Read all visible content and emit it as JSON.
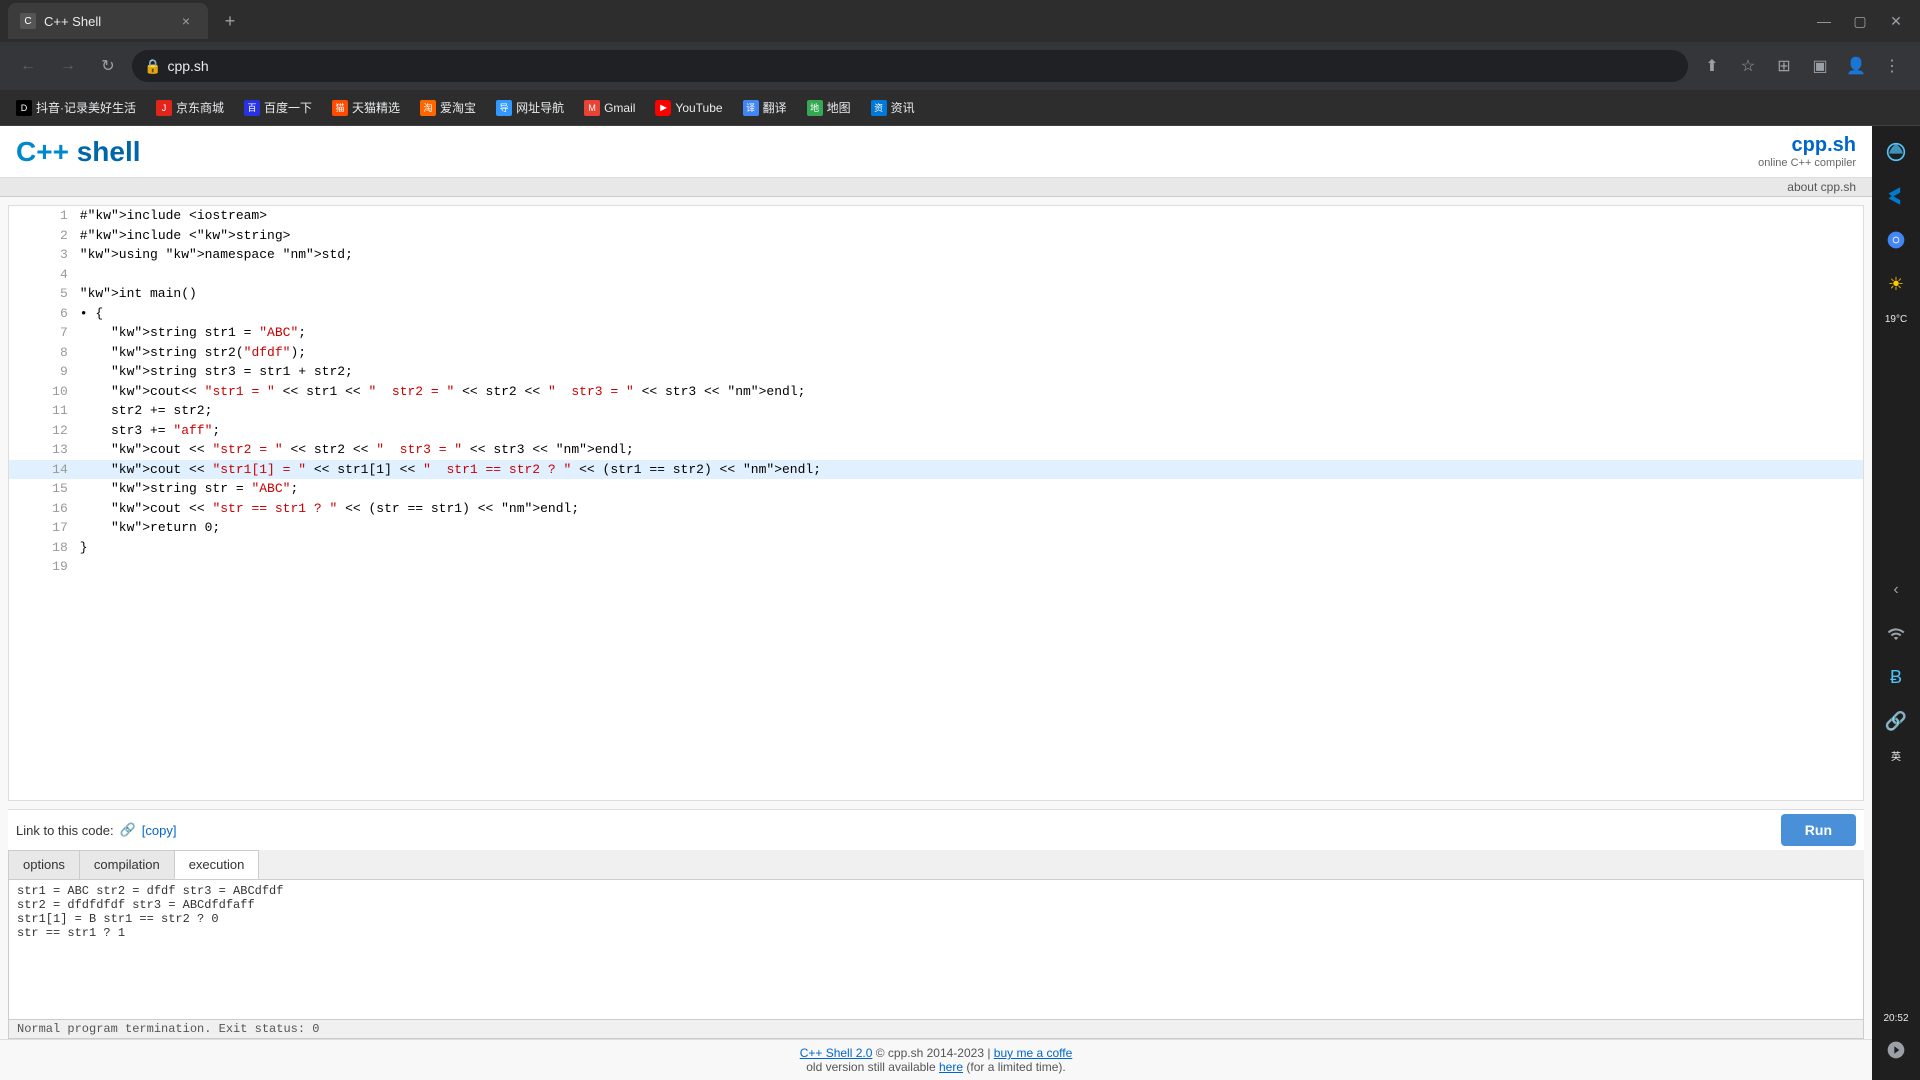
{
  "browser": {
    "tab": {
      "favicon": "C",
      "title": "C++ Shell",
      "close_label": "×"
    },
    "new_tab_label": "+",
    "window_controls": {
      "minimize": "—",
      "maximize": "▢",
      "close": "✕"
    },
    "nav": {
      "back_label": "←",
      "forward_label": "→",
      "refresh_label": "↻"
    },
    "address": "cpp.sh",
    "toolbar_icons": [
      "⬆",
      "☆",
      "⊞",
      "▣",
      "👤",
      "⋮"
    ]
  },
  "bookmarks": [
    {
      "id": "douyin",
      "icon": "D",
      "label": "抖音·记录美好生活"
    },
    {
      "id": "jingdong",
      "icon": "J",
      "label": "京东商城"
    },
    {
      "id": "baidu",
      "icon": "百",
      "label": "百度一下"
    },
    {
      "id": "tianmao",
      "icon": "猫",
      "label": "天猫精选"
    },
    {
      "id": "aicaibao",
      "icon": "淘",
      "label": "爱淘宝"
    },
    {
      "id": "wangzhi",
      "icon": "导",
      "label": "网址导航"
    },
    {
      "id": "gmail",
      "icon": "M",
      "label": "Gmail"
    },
    {
      "id": "youtube",
      "icon": "▶",
      "label": "YouTube"
    },
    {
      "id": "fanyi",
      "icon": "译",
      "label": "翻译"
    },
    {
      "id": "ditu",
      "icon": "地",
      "label": "地图"
    },
    {
      "id": "zixun",
      "icon": "资",
      "label": "资讯"
    }
  ],
  "site": {
    "logo": "C++ shell",
    "brand_name": "cpp.sh",
    "brand_sub": "online C++ compiler",
    "about_link": "about cpp.sh"
  },
  "code": {
    "lines": [
      {
        "num": 1,
        "content": "#include <iostream>",
        "highlighted": false
      },
      {
        "num": 2,
        "content": "#include <string>",
        "highlighted": false
      },
      {
        "num": 3,
        "content": "using namespace std;",
        "highlighted": false
      },
      {
        "num": 4,
        "content": "",
        "highlighted": false
      },
      {
        "num": 5,
        "content": "int main()",
        "highlighted": false
      },
      {
        "num": 6,
        "content": "• {",
        "highlighted": false
      },
      {
        "num": 7,
        "content": "    string str1 = \"ABC\";",
        "highlighted": false
      },
      {
        "num": 8,
        "content": "    string str2(\"dfdf\");",
        "highlighted": false
      },
      {
        "num": 9,
        "content": "    string str3 = str1 + str2;",
        "highlighted": false
      },
      {
        "num": 10,
        "content": "    cout<< \"str1 = \" << str1 << \"  str2 = \" << str2 << \"  str3 = \" << str3 << endl;",
        "highlighted": false
      },
      {
        "num": 11,
        "content": "    str2 += str2;",
        "highlighted": false
      },
      {
        "num": 12,
        "content": "    str3 += \"aff\";",
        "highlighted": false
      },
      {
        "num": 13,
        "content": "    cout << \"str2 = \" << str2 << \"  str3 = \" << str3 << endl;",
        "highlighted": false
      },
      {
        "num": 14,
        "content": "    cout << \"str1[1] = \" << str1[1] << \"  str1 == str2 ? \" << (str1 == str2) << endl;",
        "highlighted": true
      },
      {
        "num": 15,
        "content": "    string str = \"ABC\";",
        "highlighted": false
      },
      {
        "num": 16,
        "content": "    cout << \"str == str1 ? \" << (str == str1) << endl;",
        "highlighted": false
      },
      {
        "num": 17,
        "content": "    return 0;",
        "highlighted": false
      },
      {
        "num": 18,
        "content": "}",
        "highlighted": false
      },
      {
        "num": 19,
        "content": "",
        "highlighted": false
      }
    ]
  },
  "link_section": {
    "label": "Link to this code:",
    "copy_label": "[copy]"
  },
  "run_button": "Run",
  "tabs": [
    {
      "id": "options",
      "label": "options",
      "active": false
    },
    {
      "id": "compilation",
      "label": "compilation",
      "active": false
    },
    {
      "id": "execution",
      "label": "execution",
      "active": true
    }
  ],
  "output": {
    "lines": [
      "str1 = ABC  str2 = dfdf  str3 = ABCdfdf",
      "str2 = dfdfdfdf  str3 = ABCdfdfaff",
      "str1[1] = B  str1 == str2 ? 0",
      "str == str1 ? 1"
    ],
    "status": "Normal program termination. Exit status: 0"
  },
  "footer": {
    "link_text": "C++ Shell 2.0",
    "copyright": "© cpp.sh 2014-2023 |",
    "coffee_text": "buy me a coffe",
    "old_version": "old version still available",
    "here": "here",
    "limited": "(for a limited time)."
  },
  "edge_sidebar": {
    "temp": "19°C",
    "time": "20:52",
    "lang": "英",
    "collapse_label": "‹"
  },
  "status_bar": {
    "mode": "Normal"
  }
}
